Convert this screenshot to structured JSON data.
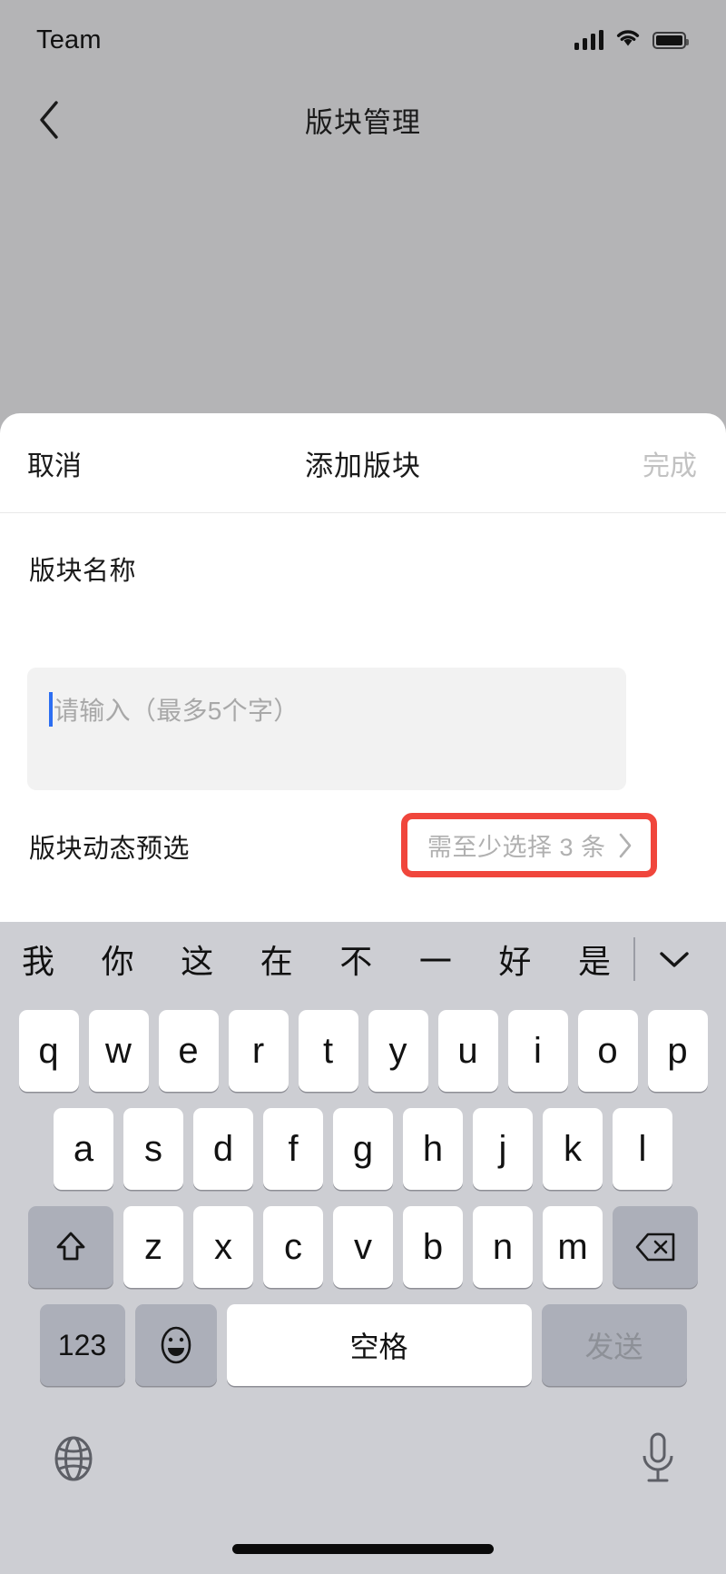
{
  "status_bar": {
    "carrier": "Team",
    "signal_icon": "signal-bars-icon",
    "wifi_icon": "wifi-icon",
    "battery_icon": "battery-full-icon"
  },
  "nav_bar": {
    "back_icon": "chevron-left-icon",
    "title": "版块管理"
  },
  "sheet": {
    "cancel_label": "取消",
    "title": "添加版块",
    "done_label": "完成",
    "field_label": "版块名称",
    "name_input": {
      "value": "",
      "placeholder": "请输入（最多5个字）"
    },
    "preselect": {
      "label": "版块动态预选",
      "value": "需至少选择 3 条",
      "chevron_icon": "chevron-right-icon",
      "highlight_color": "#f0463c"
    }
  },
  "keyboard": {
    "candidates": [
      "我",
      "你",
      "这",
      "在",
      "不",
      "一",
      "好",
      "是"
    ],
    "collapse_icon": "chevron-down-icon",
    "row1": [
      "q",
      "w",
      "e",
      "r",
      "t",
      "y",
      "u",
      "i",
      "o",
      "p"
    ],
    "row2": [
      "a",
      "s",
      "d",
      "f",
      "g",
      "h",
      "j",
      "k",
      "l"
    ],
    "row3": [
      "z",
      "x",
      "c",
      "v",
      "b",
      "n",
      "m"
    ],
    "shift_icon": "shift-arrow-icon",
    "delete_icon": "backspace-icon",
    "num_label": "123",
    "emoji_icon": "smiley-face-icon",
    "space_label": "空格",
    "send_label": "发送",
    "globe_icon": "globe-icon",
    "mic_icon": "microphone-icon"
  },
  "home_indicator": "home-indicator-bar"
}
